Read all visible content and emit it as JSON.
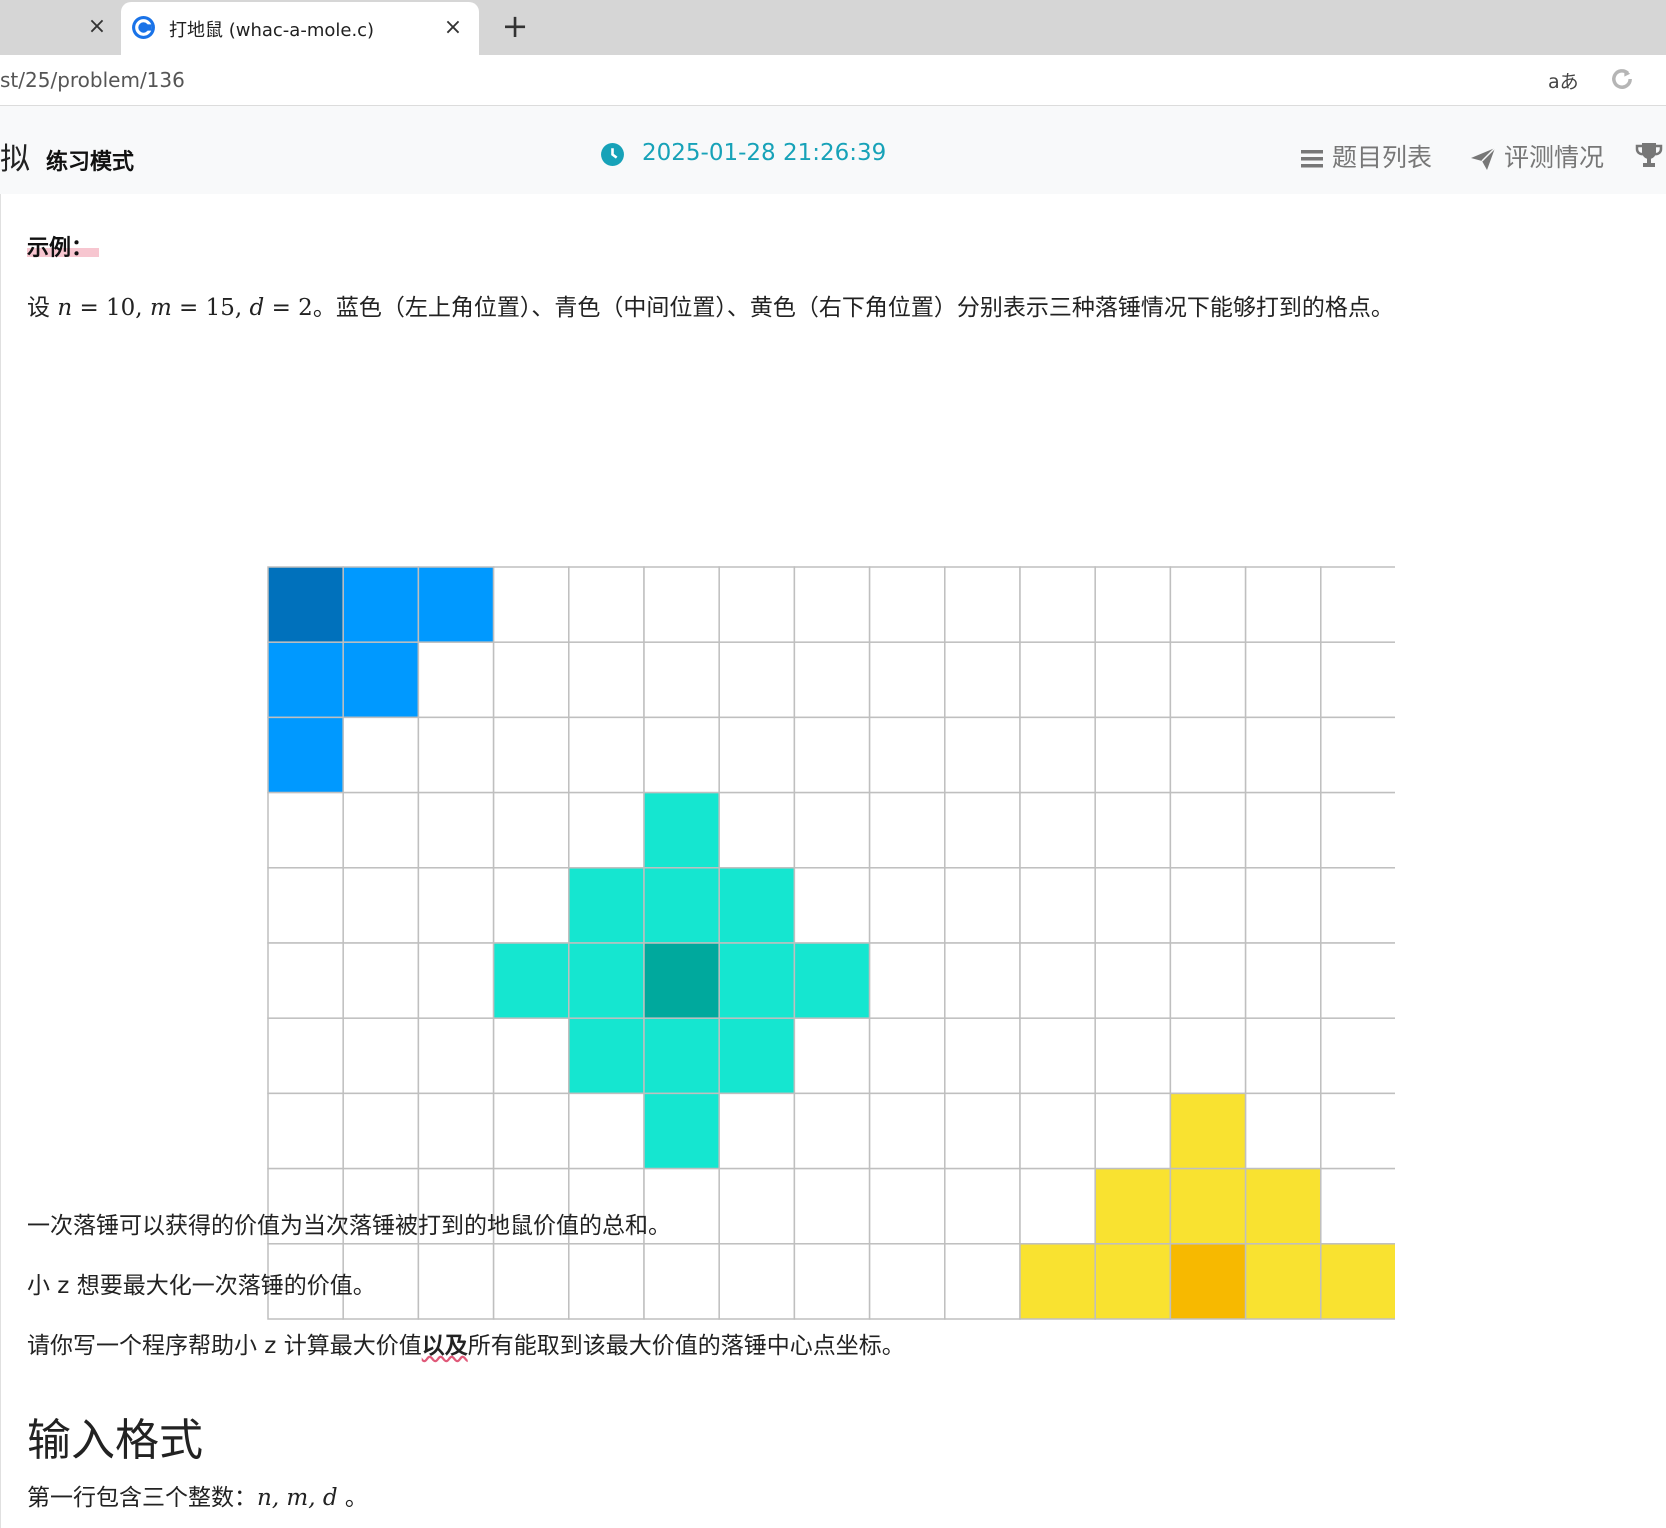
{
  "browser": {
    "prev_tab_close": "×",
    "tab_title": "打地鼠 (whac-a-mole.c)",
    "tab_close": "×",
    "new_tab": "+",
    "url": "st/25/problem/136",
    "translate_label": "aあ"
  },
  "header": {
    "brand": "拟",
    "mode": "练习模式",
    "timer": "2025-01-28 21:26:39",
    "nav_problems": "题目列表",
    "nav_status": "评测情况"
  },
  "content": {
    "example_label": "示例：",
    "example_text_pre": "设 ",
    "example_math": {
      "n": "n",
      "eq1": " = 10, ",
      "m": "m",
      "eq2": " = 15, ",
      "d": "d",
      "eq3": " = 2"
    },
    "example_text_post": "。蓝色（左上角位置）、青色（中间位置）、黄色（右下角位置）分别表示三种落锤情况下能够打到的格点。",
    "para1": "一次落锤可以获得的价值为当次落锤被打到的地鼠价值的总和。",
    "para2": "小 z 想要最大化一次落锤的价值。",
    "para3_pre": "请你写一个程序帮助小 z 计算最大价值",
    "para3_bold": "以及",
    "para3_post": "所有能取到该最大价值的落锤中心点坐标。",
    "input_heading": "输入格式",
    "input_text_pre": "第一行包含三个整数：",
    "input_math": "n, m, d",
    "input_text_post": " 。"
  },
  "grid": {
    "rows": 10,
    "cols": 15,
    "colors": {
      "empty": "#ffffff",
      "line": "#bfbfbf",
      "blue": "#0099ff",
      "blue_center": "#0071bc",
      "cyan": "#15e6d0",
      "cyan_center": "#00a99d",
      "yellow": "#f9e230",
      "yellow_center": "#f7b900"
    },
    "groups": [
      {
        "name": "blue",
        "center": [
          0,
          0
        ],
        "cells": [
          [
            0,
            1
          ],
          [
            0,
            2
          ],
          [
            1,
            0
          ],
          [
            1,
            1
          ],
          [
            2,
            0
          ]
        ]
      },
      {
        "name": "cyan",
        "center": [
          5,
          5
        ],
        "cells": [
          [
            3,
            5
          ],
          [
            4,
            4
          ],
          [
            4,
            5
          ],
          [
            4,
            6
          ],
          [
            5,
            3
          ],
          [
            5,
            4
          ],
          [
            5,
            6
          ],
          [
            5,
            7
          ],
          [
            6,
            4
          ],
          [
            6,
            5
          ],
          [
            6,
            6
          ],
          [
            7,
            5
          ]
        ]
      },
      {
        "name": "yellow",
        "center": [
          9,
          12
        ],
        "cells": [
          [
            7,
            12
          ],
          [
            8,
            11
          ],
          [
            8,
            12
          ],
          [
            8,
            13
          ],
          [
            9,
            10
          ],
          [
            9,
            11
          ],
          [
            9,
            13
          ],
          [
            9,
            14
          ]
        ]
      }
    ]
  }
}
